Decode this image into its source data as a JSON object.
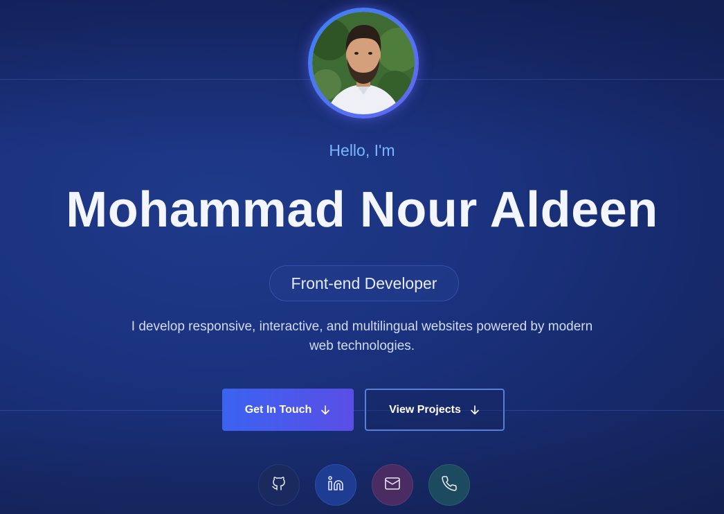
{
  "hero": {
    "greeting": "Hello, I'm",
    "name": "Mohammad Nour Aldeen",
    "role": "Front-end Developer",
    "description": "I develop responsive, interactive, and multilingual websites powered by modern web technologies."
  },
  "buttons": {
    "primary_label": "Get In Touch",
    "secondary_label": "View Projects"
  },
  "social": [
    {
      "icon": "github-icon"
    },
    {
      "icon": "linkedin-icon"
    },
    {
      "icon": "mail-icon"
    },
    {
      "icon": "phone-icon"
    }
  ],
  "colors": {
    "accent": "#7cb6ff",
    "primary_button_start": "#3b63f0",
    "primary_button_end": "#5a4ee6"
  }
}
